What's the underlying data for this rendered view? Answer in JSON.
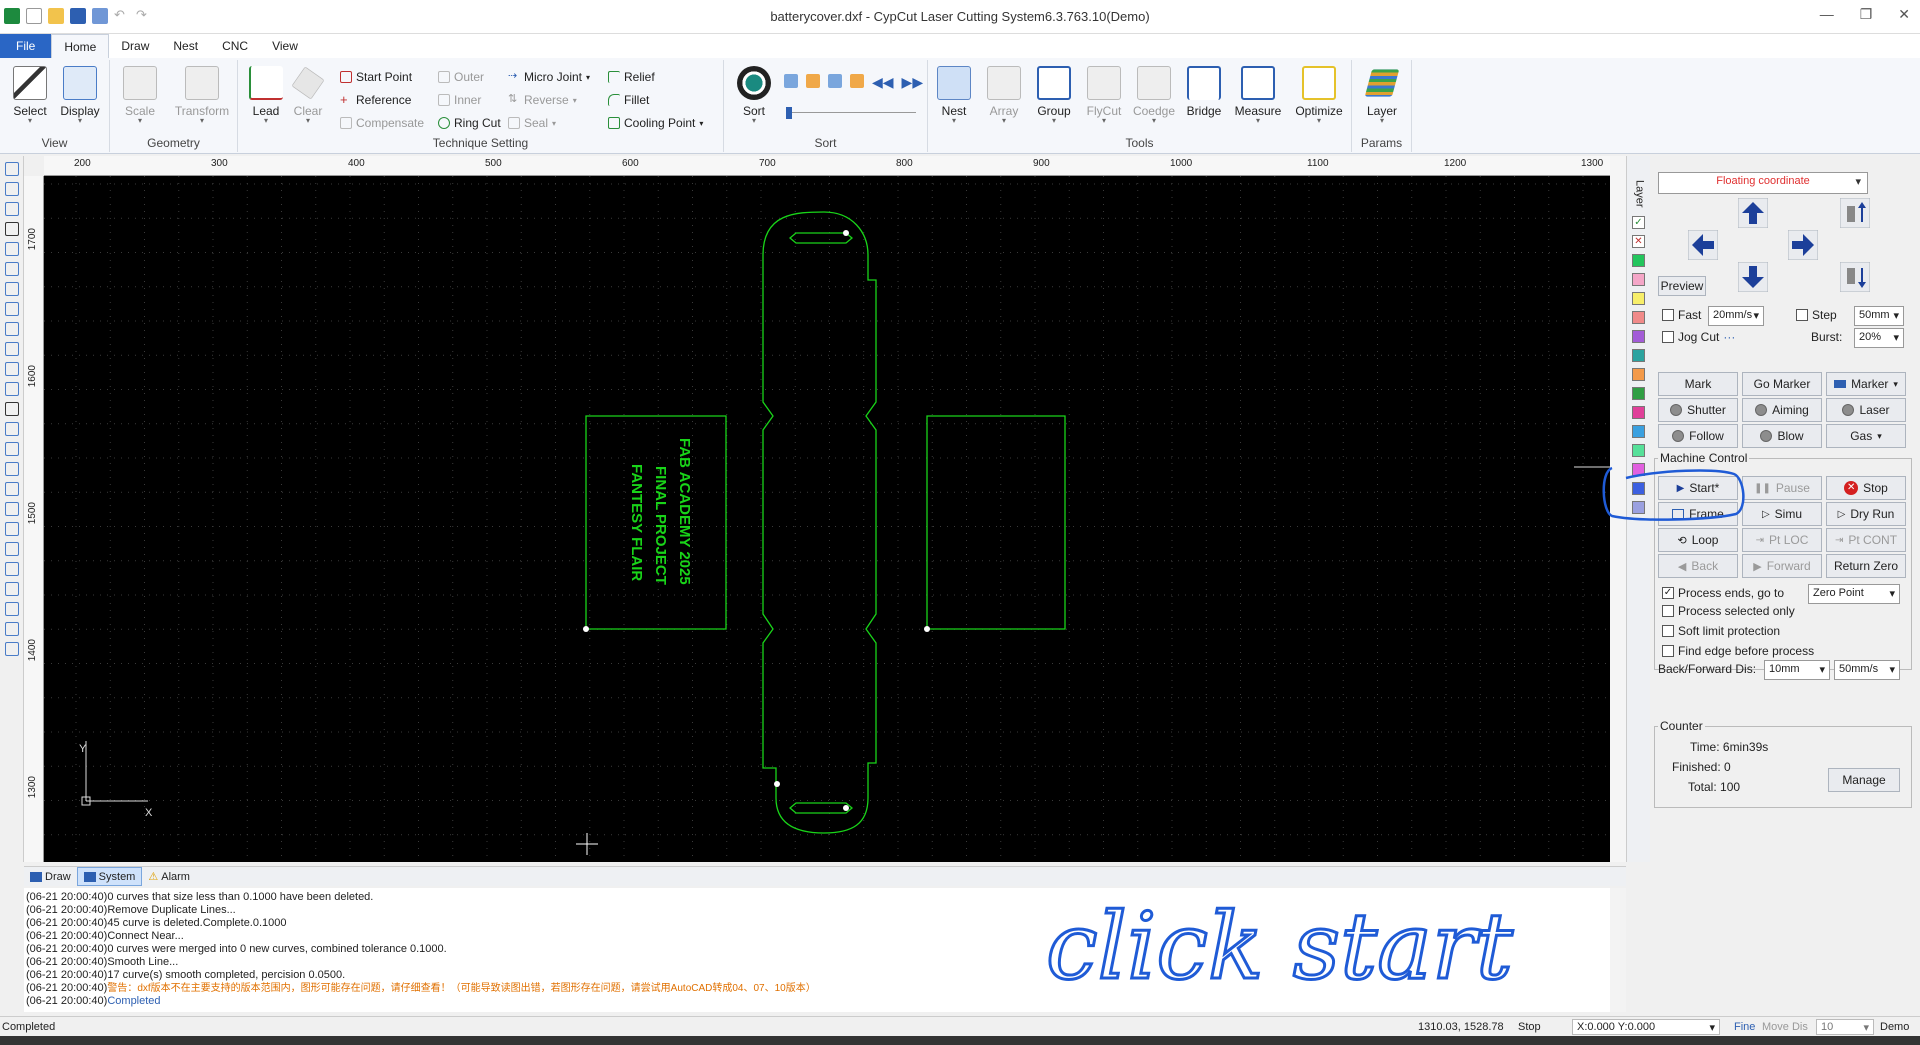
{
  "window": {
    "title": "batterycover.dxf - CypCut Laser Cutting System6.3.763.10(Demo)"
  },
  "tabs": [
    "File",
    "Home",
    "Draw",
    "Nest",
    "CNC",
    "View"
  ],
  "ribbon": {
    "view": {
      "label": "View",
      "select": "Select",
      "display": "Display"
    },
    "geometry": {
      "label": "Geometry",
      "scale": "Scale",
      "transform": "Transform"
    },
    "technique": {
      "label": "Technique Setting",
      "lead": "Lead",
      "clear": "Clear",
      "start_point": "Start Point",
      "reference": "Reference",
      "compensate": "Compensate",
      "outer": "Outer",
      "inner": "Inner",
      "ring_cut": "Ring Cut",
      "micro_joint": "Micro Joint",
      "reverse": "Reverse",
      "seal": "Seal",
      "relief": "Relief",
      "fillet": "Fillet",
      "cooling_point": "Cooling Point"
    },
    "sort": {
      "label": "Sort",
      "sort": "Sort"
    },
    "tools": {
      "label": "Tools",
      "nest": "Nest",
      "array": "Array",
      "group": "Group",
      "flycut": "FlyCut",
      "coedge": "Coedge",
      "bridge": "Bridge",
      "measure": "Measure",
      "optimize": "Optimize"
    },
    "params": {
      "label": "Params",
      "layer": "Layer"
    }
  },
  "ruler": {
    "x": [
      "200",
      "300",
      "400",
      "500",
      "600",
      "700",
      "800",
      "900",
      "1000",
      "1100",
      "1200",
      "1300"
    ],
    "y": [
      "1700",
      "1600",
      "1500",
      "1400",
      "1300"
    ]
  },
  "canvas": {
    "part_text": [
      "FAB ACADEMY 2025",
      "FINAL PROJECT",
      "FANTESY FLAIR"
    ],
    "axis_x": "X",
    "axis_y": "Y",
    "annotation": "click start",
    "colors": {
      "background": "#000000",
      "geometry": "#19d419",
      "annotation": "#1f5bd6"
    }
  },
  "layer_strip": {
    "label": "Layer"
  },
  "panel": {
    "coord_mode": "Floating coordinate",
    "preview": "Preview",
    "fast": "Fast",
    "fast_speed": "20mm/s",
    "step": "Step",
    "step_dist": "50mm",
    "jog_cut": "Jog Cut",
    "jog_more": "···",
    "burst_label": "Burst:",
    "burst": "20%",
    "mark": "Mark",
    "go_marker": "Go Marker",
    "marker": "Marker",
    "shutter": "Shutter",
    "aiming": "Aiming",
    "laser": "Laser",
    "follow": "Follow",
    "blow": "Blow",
    "gas": "Gas",
    "machine_control": "Machine Control",
    "start": "Start*",
    "pause": "Pause",
    "stop": "Stop",
    "frame": "Frame",
    "simu": "Simu",
    "dry_run": "Dry Run",
    "loop": "Loop",
    "pt_loc": "Pt LOC",
    "pt_cont": "Pt CONT",
    "back": "Back",
    "forward": "Forward",
    "return_zero": "Return Zero",
    "process_ends": "Process ends, go to",
    "process_ends_target": "Zero Point",
    "process_selected": "Process selected only",
    "soft_limit": "Soft limit protection",
    "find_edge": "Find edge before process",
    "back_forward_label": "Back/Forward Dis:",
    "back_forward_dist": "10mm",
    "back_forward_speed": "50mm/s",
    "counter": {
      "title": "Counter",
      "time": "Time: 6min39s",
      "finished": "Finished: 0",
      "total": "Total: 100",
      "manage": "Manage"
    }
  },
  "log_tabs": [
    "Draw",
    "System",
    "Alarm"
  ],
  "log": [
    {
      "time": "(06-21 20:00:40)",
      "msg": "0 curves that size less than 0.1000 have been deleted."
    },
    {
      "time": "(06-21 20:00:40)",
      "msg": "Remove Duplicate Lines..."
    },
    {
      "time": "(06-21 20:00:40)",
      "msg": "45 curve is deleted.Complete.0.1000"
    },
    {
      "time": "(06-21 20:00:40)",
      "msg": "Connect Near..."
    },
    {
      "time": "(06-21 20:00:40)",
      "msg": "0 curves were merged into 0 new curves, combined tolerance 0.1000."
    },
    {
      "time": "(06-21 20:00:40)",
      "msg": "Smooth Line..."
    },
    {
      "time": "(06-21 20:00:40)",
      "msg": "17 curve(s) smooth completed, percision 0.0500."
    },
    {
      "time": "(06-21 20:00:40)",
      "msg": "警告：dxf版本不在主要支持的版本范围内，图形可能存在问题，请仔细查看！（可能导致读图出错，若图形存在问题，请尝试用AutoCAD转成04、07、10版本）"
    },
    {
      "time": "(06-21 20:00:40)",
      "msg": "Completed"
    }
  ],
  "status": {
    "left": "Completed",
    "coords": "1310.03, 1528.78",
    "state": "Stop",
    "xy": "X:0.000 Y:0.000",
    "fine": "Fine",
    "move_dis": "Move Dis",
    "move_val": "10",
    "mode": "Demo"
  }
}
